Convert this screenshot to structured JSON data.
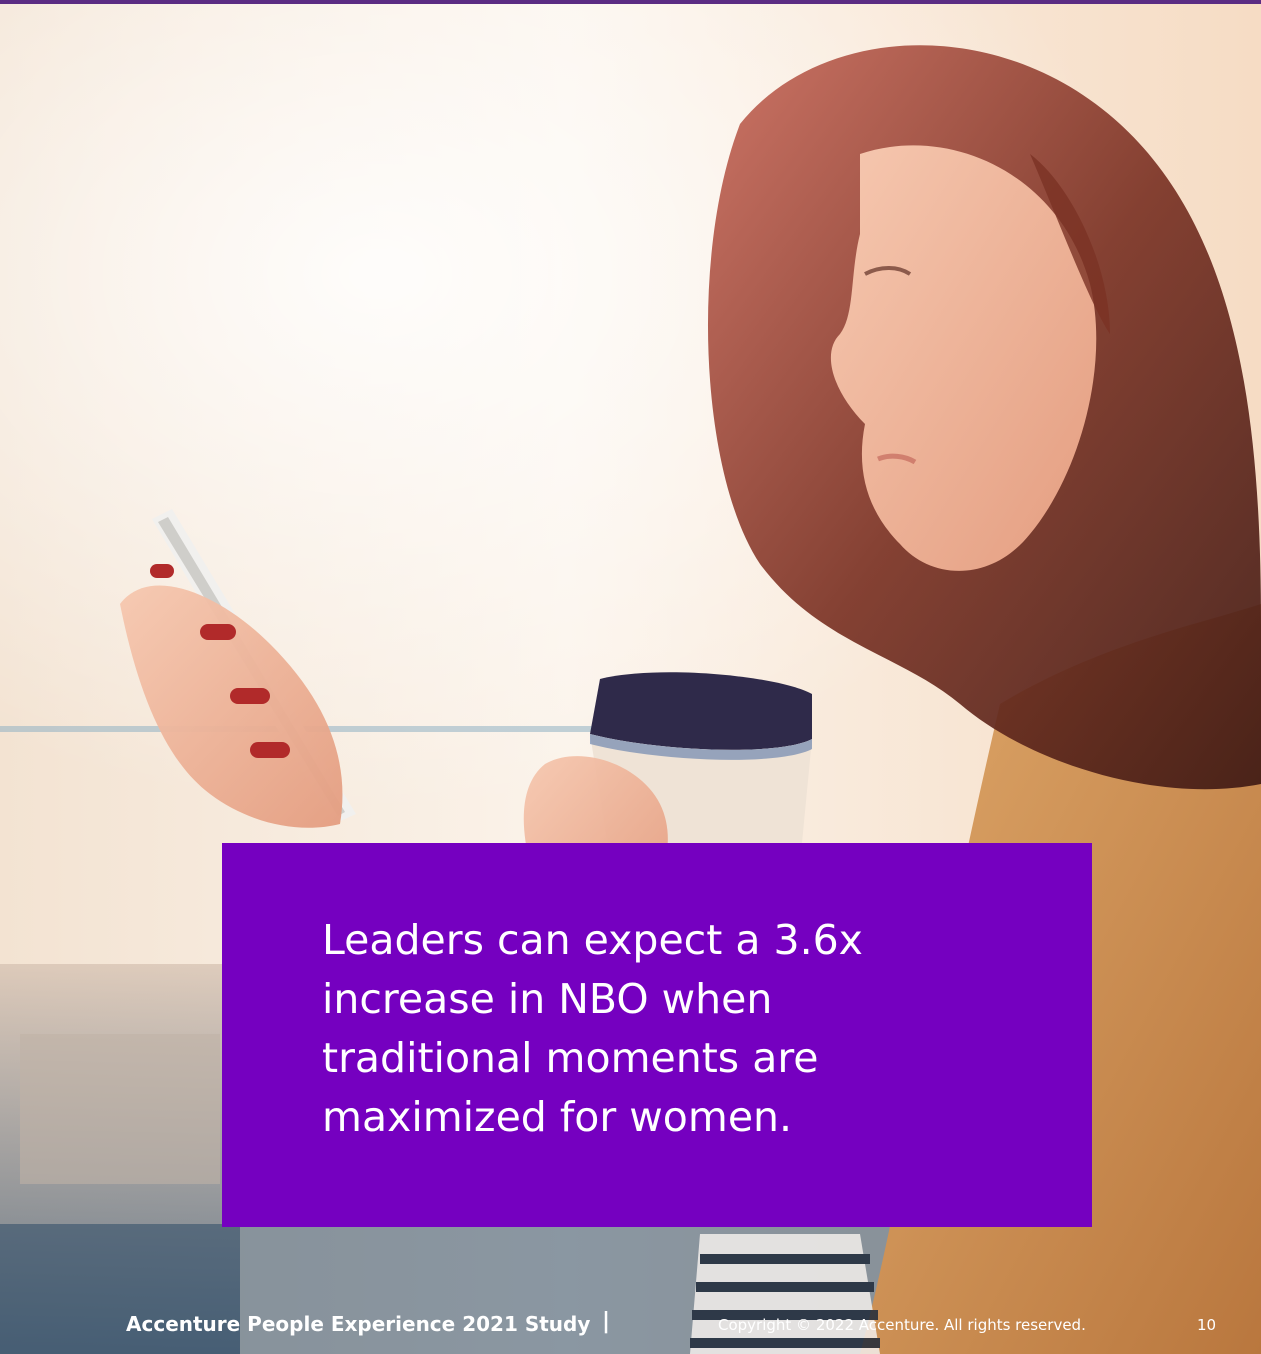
{
  "callout": {
    "text": "Leaders can expect a 3.6x increase in NBO when traditional moments are maximized for women."
  },
  "footer": {
    "study": "Accenture People Experience 2021 Study",
    "separator": "|",
    "copyright": "Copyright © 2022 Accenture. All rights reserved.",
    "page_number": "10"
  },
  "colors": {
    "accent_purple": "#7500c0",
    "top_rule": "#5b2c83"
  }
}
